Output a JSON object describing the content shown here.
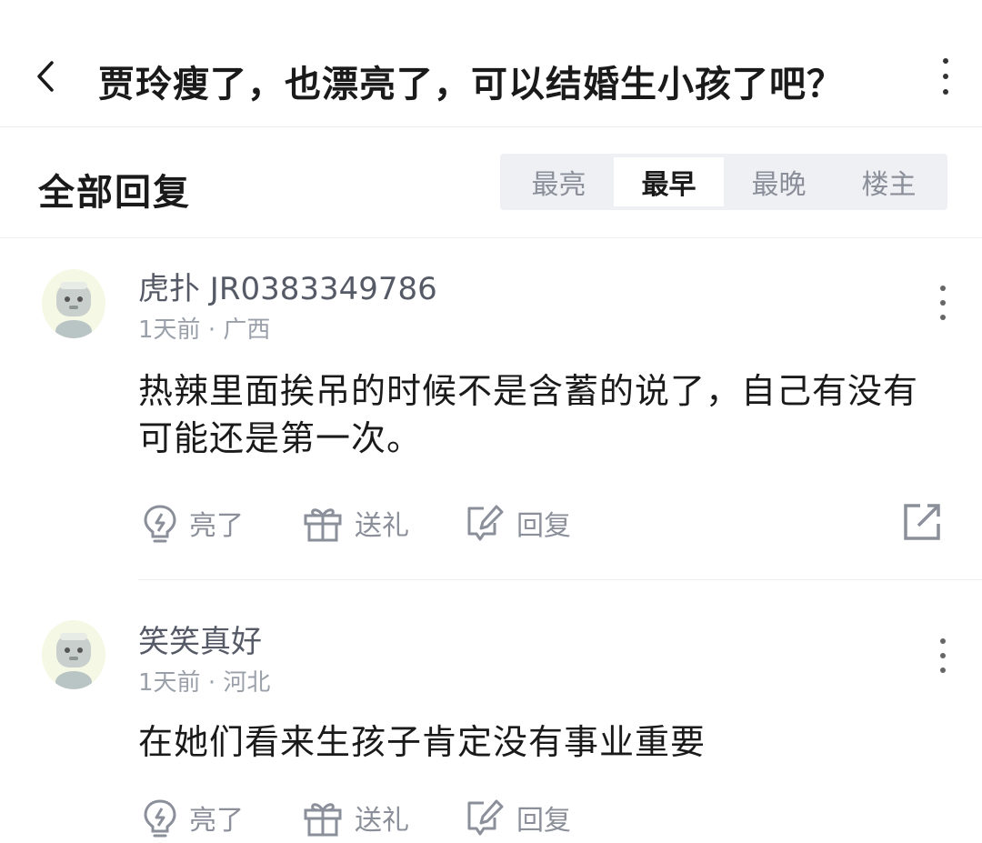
{
  "header": {
    "title": "贾玲瘦了，也漂亮了，可以结婚生小孩了吧？"
  },
  "section": {
    "title": "全部回复",
    "tabs": [
      {
        "label": "最亮",
        "active": false
      },
      {
        "label": "最早",
        "active": true
      },
      {
        "label": "最晚",
        "active": false
      },
      {
        "label": "楼主",
        "active": false
      }
    ]
  },
  "replies": [
    {
      "username": "虎扑 JR0383349786",
      "time": "1天前",
      "location": "广西",
      "content": "热辣里面挨吊的时候不是含蓄的说了，自己有没有可能还是第一次。",
      "actions": {
        "like": "亮了",
        "gift": "送礼",
        "reply": "回复"
      }
    },
    {
      "username": "笑笑真好",
      "time": "1天前",
      "location": "河北",
      "content": "在她们看来生孩子肯定没有事业重要",
      "actions": {
        "like": "亮了",
        "gift": "送礼",
        "reply": "回复"
      }
    }
  ],
  "colors": {
    "text_primary": "#1a1a1a",
    "text_secondary": "#8a8f99",
    "tab_bg": "#eef0f4"
  }
}
